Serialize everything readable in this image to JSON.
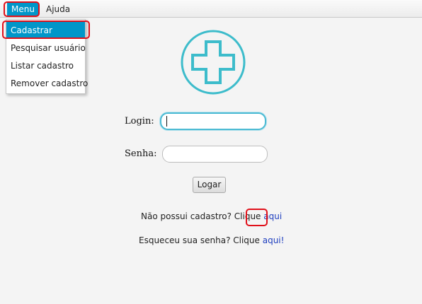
{
  "menubar": {
    "items": [
      {
        "label": "Menu"
      },
      {
        "label": "Ajuda"
      }
    ]
  },
  "dropdown": {
    "items": [
      {
        "label": "Cadastrar"
      },
      {
        "label": "Pesquisar usuário"
      },
      {
        "label": "Listar cadastro"
      },
      {
        "label": "Remover cadastro"
      }
    ]
  },
  "logo": {
    "icon": "medical-cross-icon",
    "color": "#3dbccb"
  },
  "form": {
    "login_label": "Login:",
    "login_value": "",
    "password_label": "Senha:",
    "password_value": "",
    "submit_label": "Logar"
  },
  "links": {
    "register_text": "Não possui cadastro? Clique ",
    "register_link": "aqui",
    "forgot_text": "Esqueceu sua senha? Clique ",
    "forgot_link": "aqui!"
  },
  "colors": {
    "accent": "#0096c9",
    "highlight": "#e0101a",
    "link": "#1f3fbf"
  }
}
